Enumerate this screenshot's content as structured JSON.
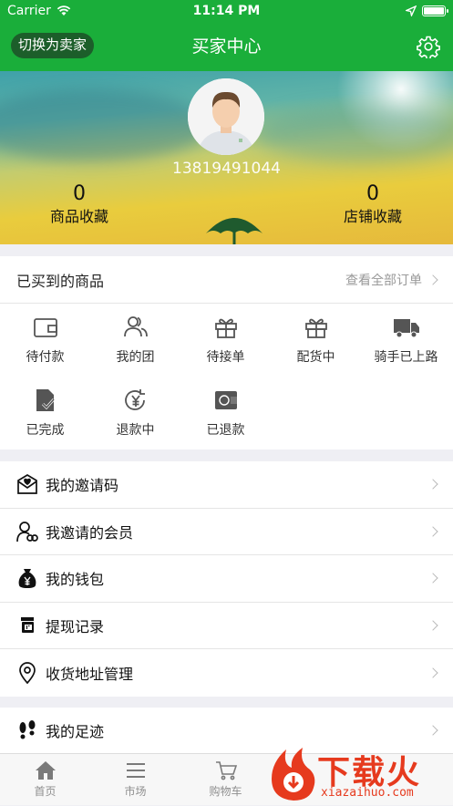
{
  "status_bar": {
    "carrier": "Carrier",
    "time": "11:14 PM"
  },
  "nav": {
    "switch_label": "切换为卖家",
    "title": "买家中心",
    "settings_icon": "gear-icon"
  },
  "profile": {
    "phone": "13819491044",
    "stats": [
      {
        "value": "0",
        "label": "商品收藏"
      },
      {
        "value": "0",
        "label": "店铺收藏"
      }
    ]
  },
  "orders": {
    "title": "已买到的商品",
    "view_all": "查看全部订单",
    "items": [
      {
        "label": "待付款",
        "icon": "wallet-icon"
      },
      {
        "label": "我的团",
        "icon": "group-icon"
      },
      {
        "label": "待接单",
        "icon": "gift-icon"
      },
      {
        "label": "配货中",
        "icon": "gift-icon"
      },
      {
        "label": "骑手已上路",
        "icon": "truck-icon"
      },
      {
        "label": "已完成",
        "icon": "document-check-icon"
      },
      {
        "label": "退款中",
        "icon": "refund-icon"
      },
      {
        "label": "已退款",
        "icon": "refunded-wallet-icon"
      }
    ]
  },
  "menu": [
    {
      "label": "我的邀请码",
      "icon": "invite-code-icon"
    },
    {
      "label": "我邀请的会员",
      "icon": "members-icon"
    },
    {
      "label": "我的钱包",
      "icon": "money-bag-icon"
    },
    {
      "label": "提现记录",
      "icon": "withdraw-icon"
    },
    {
      "label": "收货地址管理",
      "icon": "location-icon"
    }
  ],
  "menu2": [
    {
      "label": "我的足迹",
      "icon": "footprint-icon"
    }
  ],
  "tabbar": [
    {
      "label": "首页",
      "icon": "home-icon"
    },
    {
      "label": "市场",
      "icon": "list-icon"
    },
    {
      "label": "购物车",
      "icon": "cart-icon"
    }
  ],
  "watermark": {
    "text": "下载火",
    "subtext": "xiazaihuo.com"
  },
  "colors": {
    "brand_green": "#1aae3a",
    "watermark_red": "#e63a1e"
  }
}
